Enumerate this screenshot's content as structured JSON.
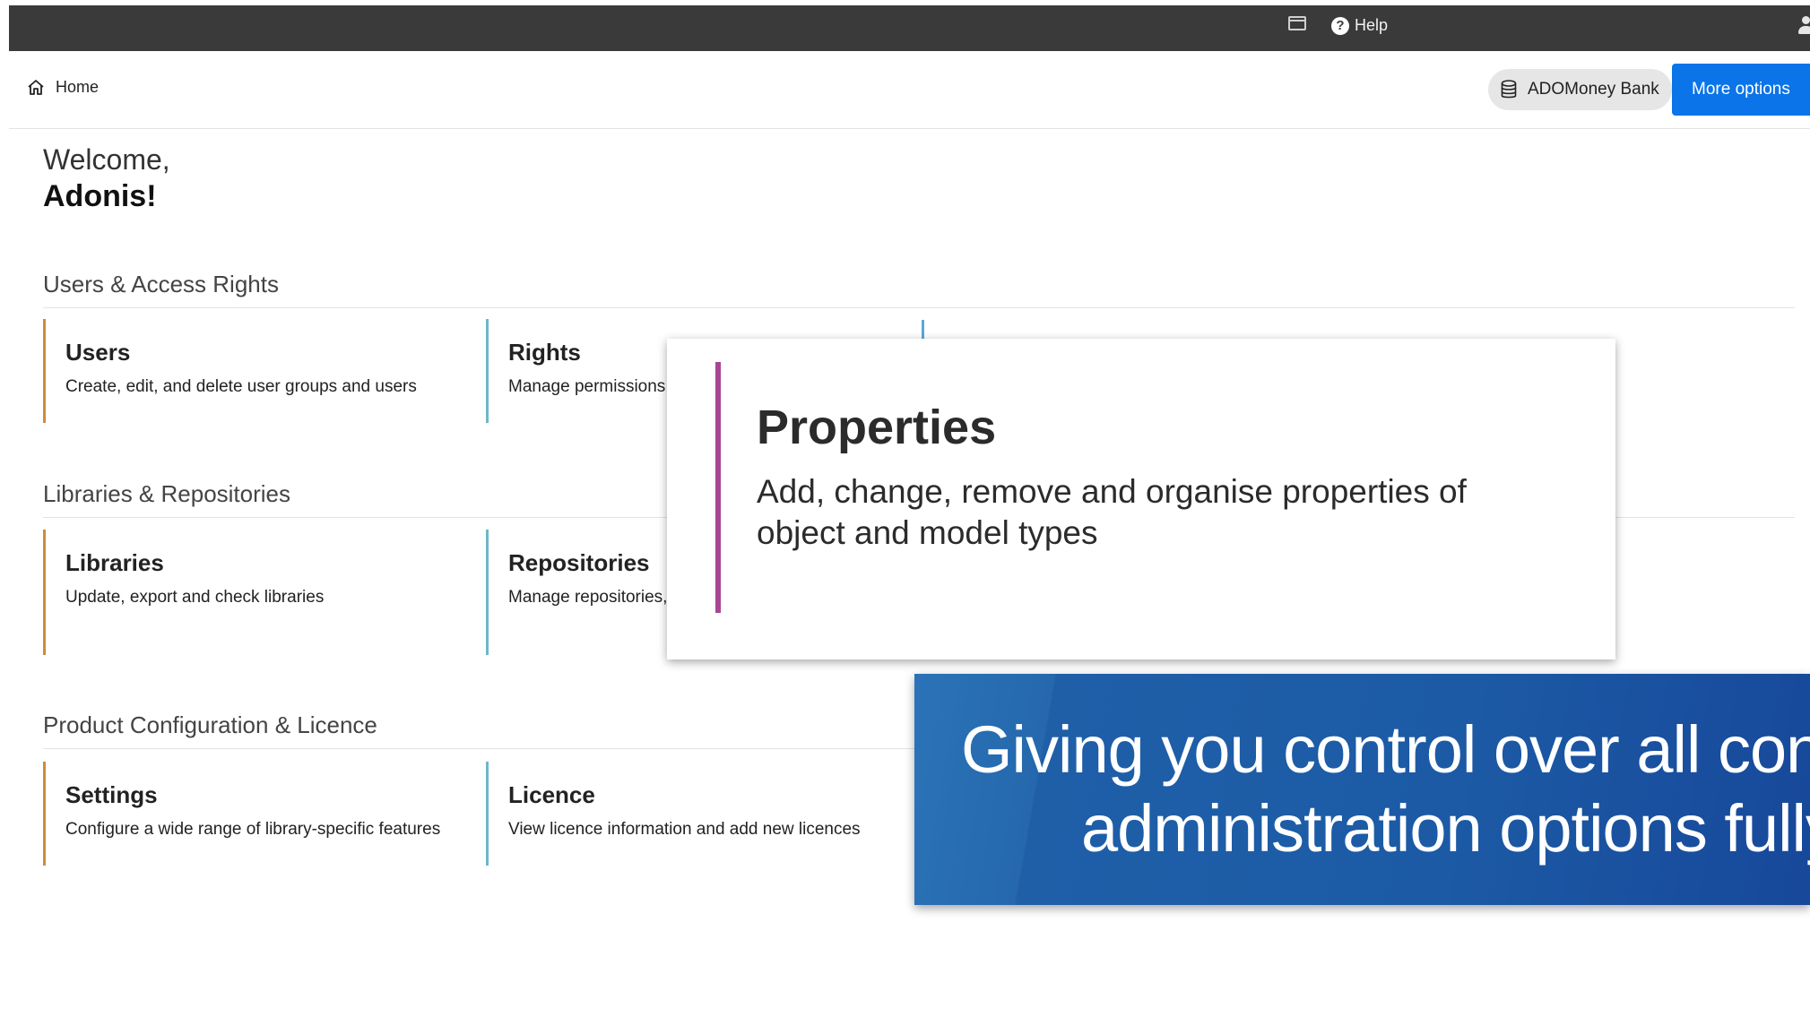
{
  "topbar": {
    "help_label": "Help",
    "icons": [
      "window-icon",
      "help-icon",
      "user-icon"
    ]
  },
  "navbar": {
    "home_label": "Home",
    "database_label": "ADOMoney Bank",
    "more_options_label": "More options"
  },
  "welcome": {
    "greeting": "Welcome,",
    "name": "Adonis!"
  },
  "sections": [
    {
      "title": "Users & Access Rights",
      "cards": [
        {
          "title": "Users",
          "description": "Create, edit, and delete user groups and users"
        },
        {
          "title": "Rights",
          "description": "Manage permissions"
        }
      ]
    },
    {
      "title": "Libraries & Repositories",
      "cards": [
        {
          "title": "Libraries",
          "description": "Update, export and check libraries"
        },
        {
          "title": "Repositories",
          "description": "Manage repositories,"
        }
      ]
    },
    {
      "title": "Product Configuration & Licence",
      "cards": [
        {
          "title": "Settings",
          "description": "Configure a wide range of library-specific features"
        },
        {
          "title": "Licence",
          "description": "View licence information and add new licences"
        }
      ]
    }
  ],
  "popup": {
    "title": "Properties",
    "description": "Add, change, remove and organise properties of object and model types"
  },
  "banner": {
    "line1": "Giving you control over all configura",
    "line2": "administration options fully on"
  },
  "colors": {
    "topbar": "#3a3a3a",
    "accent_blue": "#0a74e8",
    "card_orange": "#d08a3c",
    "card_teal": "#6fb7c9",
    "popup_accent": "#a64694",
    "banner_blue": "#1c5aa5"
  }
}
